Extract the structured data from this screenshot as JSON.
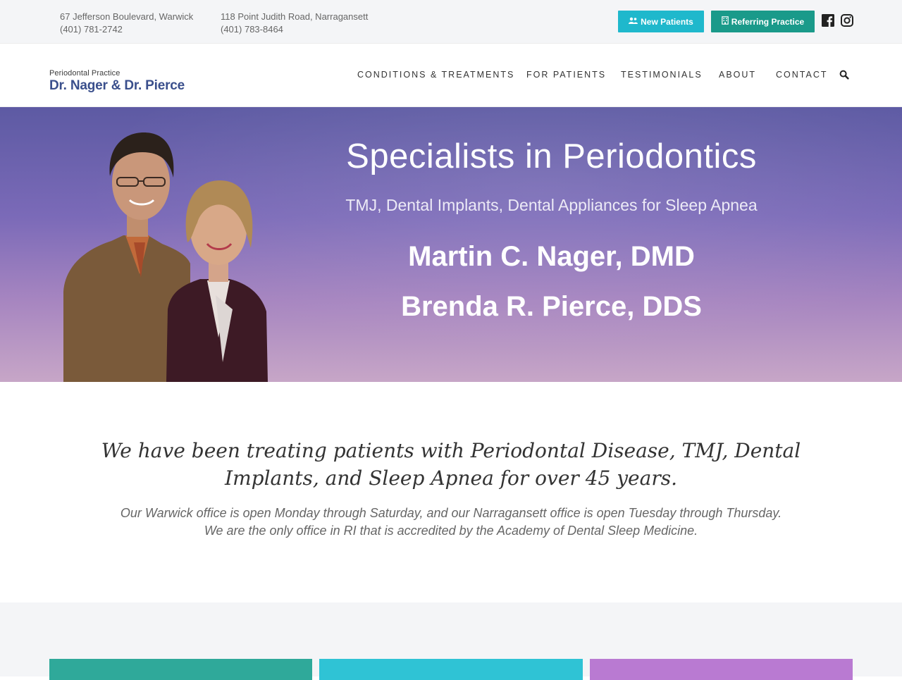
{
  "topbar": {
    "addresses": [
      {
        "street": "67 Jefferson Boulevard, Warwick",
        "phone": "(401) 781-2742"
      },
      {
        "street": "118 Point Judith Road, Narragansett",
        "phone": "(401) 783-8464"
      }
    ],
    "new_patients_label": "New Patients",
    "new_patients_icon": "users-icon",
    "new_patients_color": "#1fb8cc",
    "referring_label": "Referring Practice",
    "referring_icon": "building-icon",
    "referring_color": "#1a9a8a",
    "social": [
      "facebook-icon",
      "instagram-icon"
    ]
  },
  "header": {
    "logo_small": "Periodontal Practice",
    "logo_big": "Dr. Nager & Dr. Pierce",
    "logo_color": "#3a4f8c",
    "nav": [
      "CONDITIONS & TREATMENTS",
      "FOR PATIENTS",
      "TESTIMONIALS",
      "ABOUT",
      "CONTACT"
    ],
    "search_icon": "search-icon"
  },
  "hero": {
    "title": "Specialists in Periodontics",
    "subtitle": "TMJ, Dental Implants, Dental Appliances for Sleep Apnea",
    "name1": "Martin C. Nager, DMD",
    "name2": "Brenda R. Pierce, DDS"
  },
  "intro": {
    "headline": "We have been treating patients with Periodontal Disease, TMJ, Dental Implants, and Sleep Apnea for over 45 years.",
    "line1": "Our Warwick office is open Monday through Saturday, and our Narragansett office is open Tuesday through Thursday.",
    "line2": "We are the only office in RI that is accredited by the Academy of Dental Sleep Medicine."
  },
  "cards": {
    "colors": [
      "#2fa99a",
      "#2fc3d5",
      "#b97ad2"
    ]
  }
}
